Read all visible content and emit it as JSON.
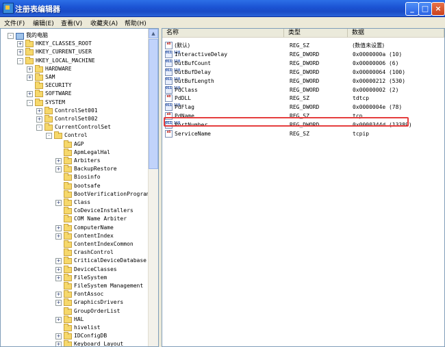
{
  "window": {
    "title": "注册表编辑器",
    "buttons": [
      "_",
      "□",
      "×"
    ]
  },
  "menu": [
    "文件(F)",
    "编辑(E)",
    "查看(V)",
    "收藏夹(A)",
    "帮助(H)"
  ],
  "tree": [
    {
      "label": "我的电脑",
      "depth": 0,
      "exp": "-",
      "icon": "pc"
    },
    {
      "label": "HKEY_CLASSES_ROOT",
      "depth": 1,
      "exp": "+"
    },
    {
      "label": "HKEY_CURRENT_USER",
      "depth": 1,
      "exp": "+"
    },
    {
      "label": "HKEY_LOCAL_MACHINE",
      "depth": 1,
      "exp": "-"
    },
    {
      "label": "HARDWARE",
      "depth": 2,
      "exp": "+"
    },
    {
      "label": "SAM",
      "depth": 2,
      "exp": "+"
    },
    {
      "label": "SECURITY",
      "depth": 2,
      "exp": ""
    },
    {
      "label": "SOFTWARE",
      "depth": 2,
      "exp": "+"
    },
    {
      "label": "SYSTEM",
      "depth": 2,
      "exp": "-"
    },
    {
      "label": "ControlSet001",
      "depth": 3,
      "exp": "+"
    },
    {
      "label": "ControlSet002",
      "depth": 3,
      "exp": "+"
    },
    {
      "label": "CurrentControlSet",
      "depth": 3,
      "exp": "-"
    },
    {
      "label": "Control",
      "depth": 4,
      "exp": "-"
    },
    {
      "label": "AGP",
      "depth": 5,
      "exp": ""
    },
    {
      "label": "ApmLegalHal",
      "depth": 5,
      "exp": ""
    },
    {
      "label": "Arbiters",
      "depth": 5,
      "exp": "+"
    },
    {
      "label": "BackupRestore",
      "depth": 5,
      "exp": "+"
    },
    {
      "label": "Biosinfo",
      "depth": 5,
      "exp": ""
    },
    {
      "label": "bootsafe",
      "depth": 5,
      "exp": ""
    },
    {
      "label": "BootVerificationProgram",
      "depth": 5,
      "exp": ""
    },
    {
      "label": "Class",
      "depth": 5,
      "exp": "+"
    },
    {
      "label": "CoDeviceInstallers",
      "depth": 5,
      "exp": ""
    },
    {
      "label": "COM Name Arbiter",
      "depth": 5,
      "exp": ""
    },
    {
      "label": "ComputerName",
      "depth": 5,
      "exp": "+"
    },
    {
      "label": "ContentIndex",
      "depth": 5,
      "exp": "+"
    },
    {
      "label": "ContentIndexCommon",
      "depth": 5,
      "exp": ""
    },
    {
      "label": "CrashControl",
      "depth": 5,
      "exp": ""
    },
    {
      "label": "CriticalDeviceDatabase",
      "depth": 5,
      "exp": "+"
    },
    {
      "label": "DeviceClasses",
      "depth": 5,
      "exp": "+"
    },
    {
      "label": "FileSystem",
      "depth": 5,
      "exp": "+"
    },
    {
      "label": "FileSystem Management",
      "depth": 5,
      "exp": ""
    },
    {
      "label": "FontAssoc",
      "depth": 5,
      "exp": "+"
    },
    {
      "label": "GraphicsDrivers",
      "depth": 5,
      "exp": "+"
    },
    {
      "label": "GroupOrderList",
      "depth": 5,
      "exp": ""
    },
    {
      "label": "HAL",
      "depth": 5,
      "exp": "+"
    },
    {
      "label": "hivelist",
      "depth": 5,
      "exp": ""
    },
    {
      "label": "IDConfigDB",
      "depth": 5,
      "exp": "+"
    },
    {
      "label": "Keyboard Layout",
      "depth": 5,
      "exp": "+"
    }
  ],
  "columns": [
    "名称",
    "类型",
    "数据"
  ],
  "values": [
    {
      "name": "(默认)",
      "type": "REG_SZ",
      "data": "(数值未设置)",
      "icon": "ab"
    },
    {
      "name": "InteractiveDelay",
      "type": "REG_DWORD",
      "data": "0x0000000a (10)",
      "icon": "bin"
    },
    {
      "name": "OutBufCount",
      "type": "REG_DWORD",
      "data": "0x00000006 (6)",
      "icon": "bin"
    },
    {
      "name": "OutBufDelay",
      "type": "REG_DWORD",
      "data": "0x00000064 (100)",
      "icon": "bin"
    },
    {
      "name": "OutBufLength",
      "type": "REG_DWORD",
      "data": "0x00000212 (530)",
      "icon": "bin"
    },
    {
      "name": "PdClass",
      "type": "REG_DWORD",
      "data": "0x00000002 (2)",
      "icon": "bin"
    },
    {
      "name": "PdDLL",
      "type": "REG_SZ",
      "data": "tdtcp",
      "icon": "ab"
    },
    {
      "name": "PdFlag",
      "type": "REG_DWORD",
      "data": "0x0000004e (78)",
      "icon": "bin"
    },
    {
      "name": "PdName",
      "type": "REG_SZ",
      "data": "tcp",
      "icon": "ab"
    },
    {
      "name": "PortNumber",
      "type": "REG_DWORD",
      "data": "0x0000344d (13389)",
      "icon": "bin"
    },
    {
      "name": "ServiceName",
      "type": "REG_SZ",
      "data": "tcpip",
      "icon": "ab"
    }
  ],
  "icons": {
    "ab": "ab",
    "bin": "011 110"
  }
}
